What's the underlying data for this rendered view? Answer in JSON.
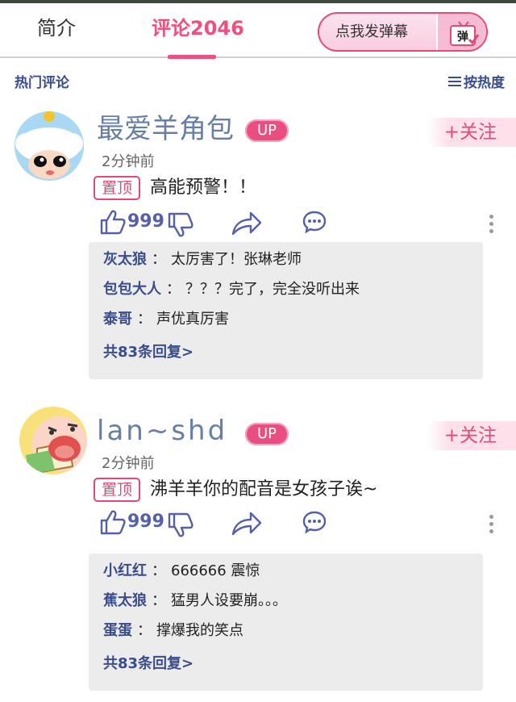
{
  "tabs": {
    "intro": "简介",
    "comments": "评论2046"
  },
  "danmaku_button": {
    "label": "点我发弹幕",
    "icon_text": "弹",
    "icon": "tv-danmaku-icon"
  },
  "subbar": {
    "hot": "热门评论",
    "sort": "按热度",
    "sort_icon": "list-lines-icon"
  },
  "comments": [
    {
      "username": "最爱羊角包",
      "badge": "UP",
      "follow": "+关注",
      "time": "2分钟前",
      "pin": "置顶",
      "content": "高能预警！！",
      "likes": "999",
      "replies": [
        {
          "user": "灰太狼",
          "colon": "：",
          "text": "太厉害了！张琳老师"
        },
        {
          "user": "包包大人",
          "colon": "：",
          "text": "？？？完了，完全没听出来"
        },
        {
          "user": "泰哥",
          "colon": "：",
          "text": "声优真厉害"
        }
      ],
      "more_replies": "共83条回复>"
    },
    {
      "username": "lan~shd",
      "badge": "UP",
      "follow": "+关注",
      "time": "2分钟前",
      "pin": "置顶",
      "content": "沸羊羊你的配音是女孩子诶~",
      "likes": "999",
      "replies": [
        {
          "user": "小红红",
          "colon": "：",
          "text": "666666 震惊"
        },
        {
          "user": "蕉太狼",
          "colon": "：",
          "text": "猛男人设要崩。。。"
        },
        {
          "user": "蛋蛋",
          "colon": "：",
          "text": "撑爆我的笑点"
        }
      ],
      "more_replies": "共83条回复>"
    }
  ],
  "colors": {
    "accent": "#e84e80",
    "link": "#3a4d8c",
    "username": "#677fa6",
    "reply_bg": "#ececec"
  }
}
